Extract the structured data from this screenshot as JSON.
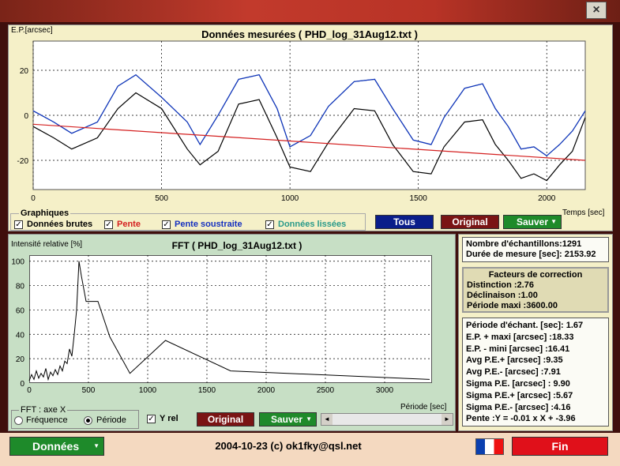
{
  "colors": {
    "raw": "#000000",
    "slope": "#d42020",
    "smoothed": "#2a9a8a",
    "subtracted": "#1530c0",
    "grid": "#000000"
  },
  "main_chart": {
    "ylabel": "E.P.[arcsec]",
    "title": "Données mesurées ( PHD_log_31Aug12.txt )",
    "xlabel": "Temps [sec]",
    "y_ticks": [
      "20",
      "0",
      "-20"
    ],
    "x_ticks": [
      "0",
      "500",
      "1000",
      "1500",
      "2000"
    ]
  },
  "graph_options": {
    "legend_title": "Graphiques",
    "raw_label": "Données brutes",
    "slope_label": "Pente",
    "subtracted_label": "Pente soustraite",
    "smoothed_label": "Données lissées",
    "check_mark": "✓",
    "all_button": "Tous",
    "original_button": "Original",
    "save_button": "Sauver"
  },
  "fft_chart": {
    "ylabel": "Intensité relative [%]",
    "title": "FFT ( PHD_log_31Aug12.txt )",
    "xlabel": "Période [sec]",
    "y_ticks": [
      "100",
      "80",
      "60",
      "40",
      "20",
      "0"
    ],
    "x_ticks": [
      "0",
      "500",
      "1000",
      "1500",
      "2000",
      "2500",
      "3000"
    ]
  },
  "fft_options": {
    "axis_group_label": "FFT : axe X",
    "frequency_label": "Fréquence",
    "period_label": "Période",
    "yrel_label": "Y rel",
    "original_button": "Original",
    "save_button": "Sauver",
    "scroll_left": "◄",
    "scroll_right": "►"
  },
  "stats": {
    "samples": "Nombre d'échantillons:1291",
    "duration": "Durée de mesure [sec]: 2153.92"
  },
  "correction": {
    "title": "Facteurs de correction",
    "distinction": "Distinction :2.76",
    "declination": "Déclinaison :1.00",
    "max_period": "Période maxi :3600.00"
  },
  "measures": [
    "Période d'échant. [sec]: 1.67",
    "E.P. + maxi [arcsec] :18.33",
    "E.P. - mini [arcsec] :16.41",
    "Avg P.E.+ [arcsec] :9.35",
    "Avg P.E.- [arcsec] :7.91",
    "Sigma P.E. [arcsec] : 9.90",
    "Sigma P.E.+ [arcsec] :5.67",
    "Sigma P.E.- [arcsec] :4.16",
    "Pente :Y = -0.01 x X + -3.96"
  ],
  "bottom": {
    "data_button": "Données",
    "footer": "2004-10-23 (c) ok1fky@qsl.net",
    "exit_button": "Fin"
  },
  "chart_data": [
    {
      "type": "line",
      "title": "Données mesurées ( PHD_log_31Aug12.txt )",
      "xlabel": "Temps [sec]",
      "ylabel": "E.P.[arcsec]",
      "xlim": [
        0,
        2150
      ],
      "ylim": [
        -33,
        33
      ],
      "series": [
        {
          "name": "Données brutes",
          "x": [
            0,
            80,
            150,
            250,
            330,
            400,
            500,
            600,
            650,
            720,
            800,
            880,
            950,
            1000,
            1080,
            1150,
            1250,
            1330,
            1400,
            1480,
            1550,
            1600,
            1680,
            1750,
            1800,
            1850,
            1900,
            1950,
            2000,
            2050,
            2100,
            2150
          ],
          "values": [
            -5,
            -10,
            -15,
            -10,
            3,
            10,
            3,
            -15,
            -22,
            -16,
            5,
            7,
            -10,
            -23,
            -25,
            -12,
            3,
            2,
            -13,
            -25,
            -26,
            -14,
            -3,
            -2,
            -13,
            -20,
            -28,
            -26,
            -29,
            -22,
            -16,
            -1
          ]
        },
        {
          "name": "Données lissées",
          "x": [
            0,
            80,
            150,
            250,
            330,
            400,
            500,
            600,
            650,
            720,
            800,
            880,
            950,
            1000,
            1080,
            1150,
            1250,
            1330,
            1400,
            1480,
            1550,
            1600,
            1680,
            1750,
            1800,
            1850,
            1900,
            1950,
            2000,
            2050,
            2100,
            2150
          ],
          "values": [
            2,
            -3,
            -8,
            -3,
            13,
            18,
            8,
            -3,
            -13,
            0,
            16,
            18,
            3,
            -14,
            -9,
            4,
            15,
            16,
            3,
            -11,
            -13,
            -1,
            12,
            14,
            3,
            -5,
            -15,
            -14,
            -18,
            -13,
            -7,
            2
          ]
        },
        {
          "name": "Pente soustraite",
          "x": [
            0,
            80,
            150,
            250,
            330,
            400,
            500,
            600,
            650,
            720,
            800,
            880,
            950,
            1000,
            1080,
            1150,
            1250,
            1330,
            1400,
            1480,
            1550,
            1600,
            1680,
            1750,
            1800,
            1850,
            1900,
            1950,
            2000,
            2050,
            2100,
            2150
          ],
          "values": [
            2,
            -3,
            -8,
            -3,
            13,
            18,
            8,
            -3,
            -13,
            0,
            16,
            18,
            3,
            -14,
            -9,
            4,
            15,
            16,
            3,
            -11,
            -13,
            -1,
            12,
            14,
            3,
            -5,
            -15,
            -14,
            -18,
            -13,
            -7,
            2
          ]
        },
        {
          "name": "Pente",
          "x": [
            0,
            2150
          ],
          "values": [
            -3.96,
            -20
          ]
        }
      ]
    },
    {
      "type": "line",
      "title": "FFT ( PHD_log_31Aug12.txt )",
      "xlabel": "Période [sec]",
      "ylabel": "Intensité relative [%]",
      "xlim": [
        0,
        3400
      ],
      "ylim": [
        0,
        105
      ],
      "series": [
        {
          "name": "FFT",
          "x": [
            0,
            20,
            40,
            60,
            80,
            100,
            120,
            140,
            160,
            180,
            200,
            220,
            240,
            260,
            280,
            300,
            320,
            340,
            360,
            380,
            400,
            420,
            440,
            480,
            520,
            580,
            680,
            850,
            1150,
            1700,
            3380
          ],
          "values": [
            2,
            7,
            3,
            10,
            4,
            8,
            5,
            12,
            3,
            9,
            6,
            11,
            7,
            14,
            10,
            18,
            16,
            28,
            22,
            40,
            60,
            100,
            88,
            67,
            67,
            67,
            38,
            8,
            35,
            10,
            3
          ]
        }
      ]
    }
  ]
}
